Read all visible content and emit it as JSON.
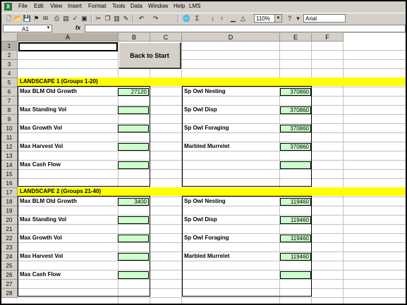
{
  "menu": [
    "File",
    "Edit",
    "View",
    "Insert",
    "Format",
    "Tools",
    "Data",
    "Window",
    "Help",
    "LMS"
  ],
  "toolbar": {
    "zoom": "110%",
    "font": "Arial",
    "icons": [
      "new-icon",
      "open-icon",
      "save-icon",
      "permission-icon",
      "email-icon",
      "print-icon",
      "print-preview-icon",
      "spelling-icon",
      "cut-icon",
      "copy-icon",
      "paste-icon",
      "format-painter-icon",
      "undo-icon",
      "redo-icon",
      "insert-hyperlink-icon",
      "autosum-icon",
      "function-icon",
      "sort-ascending-icon",
      "sort-descending-icon",
      "chart-wizard-icon",
      "drawing-icon"
    ]
  },
  "formula_bar": {
    "name_box": "A1",
    "fx": "fx",
    "value": ""
  },
  "columns": [
    "A",
    "B",
    "C",
    "D",
    "E",
    "F"
  ],
  "rows": [
    "1",
    "2",
    "3",
    "4",
    "5",
    "6",
    "7",
    "8",
    "9",
    "10",
    "11",
    "12",
    "13",
    "14",
    "15",
    "16",
    "17",
    "18",
    "19",
    "20",
    "21",
    "22",
    "23",
    "24",
    "25",
    "26",
    "27",
    "28"
  ],
  "button": {
    "label": "Back to Start"
  },
  "landscape1": {
    "title": "LANDSCAPE 1 (Groups 1-20)",
    "left": [
      {
        "label": "Max BLM Old Growth",
        "value": "27120"
      },
      {
        "label": "Max Standing Vol",
        "value": ""
      },
      {
        "label": "Max Growth Vol",
        "value": ""
      },
      {
        "label": "Max Harvest Vol",
        "value": ""
      },
      {
        "label": "Max Cash Flow",
        "value": ""
      }
    ],
    "right": [
      {
        "label": "Sp Owl Nesting",
        "value": "370860"
      },
      {
        "label": "Sp Owl Disp",
        "value": "370860"
      },
      {
        "label": "Sp Owl Foraging",
        "value": "370860"
      },
      {
        "label": "Marbled Murrelet",
        "value": "370860"
      },
      {
        "label": "",
        "value": ""
      }
    ]
  },
  "landscape2": {
    "title": "LANDSCAPE 2 (Groups 21-40)",
    "left": [
      {
        "label": "Max BLM Old Growth",
        "value": "3400"
      },
      {
        "label": "Max Standing Vol",
        "value": ""
      },
      {
        "label": "Max Growth Vol",
        "value": ""
      },
      {
        "label": "Max Harvest Vol",
        "value": ""
      },
      {
        "label": "Max Cash Flow",
        "value": ""
      }
    ],
    "right": [
      {
        "label": "Sp Owl Nesting",
        "value": "119460"
      },
      {
        "label": "Sp Owl Disp",
        "value": "119460"
      },
      {
        "label": "Sp Owl Foraging",
        "value": "119460"
      },
      {
        "label": "Marbled Murrelet",
        "value": "119460"
      },
      {
        "label": "",
        "value": ""
      }
    ]
  },
  "colors": {
    "band": "#ffff00",
    "value_fill": "#ccffcc",
    "chrome": "#d4d0c8"
  }
}
